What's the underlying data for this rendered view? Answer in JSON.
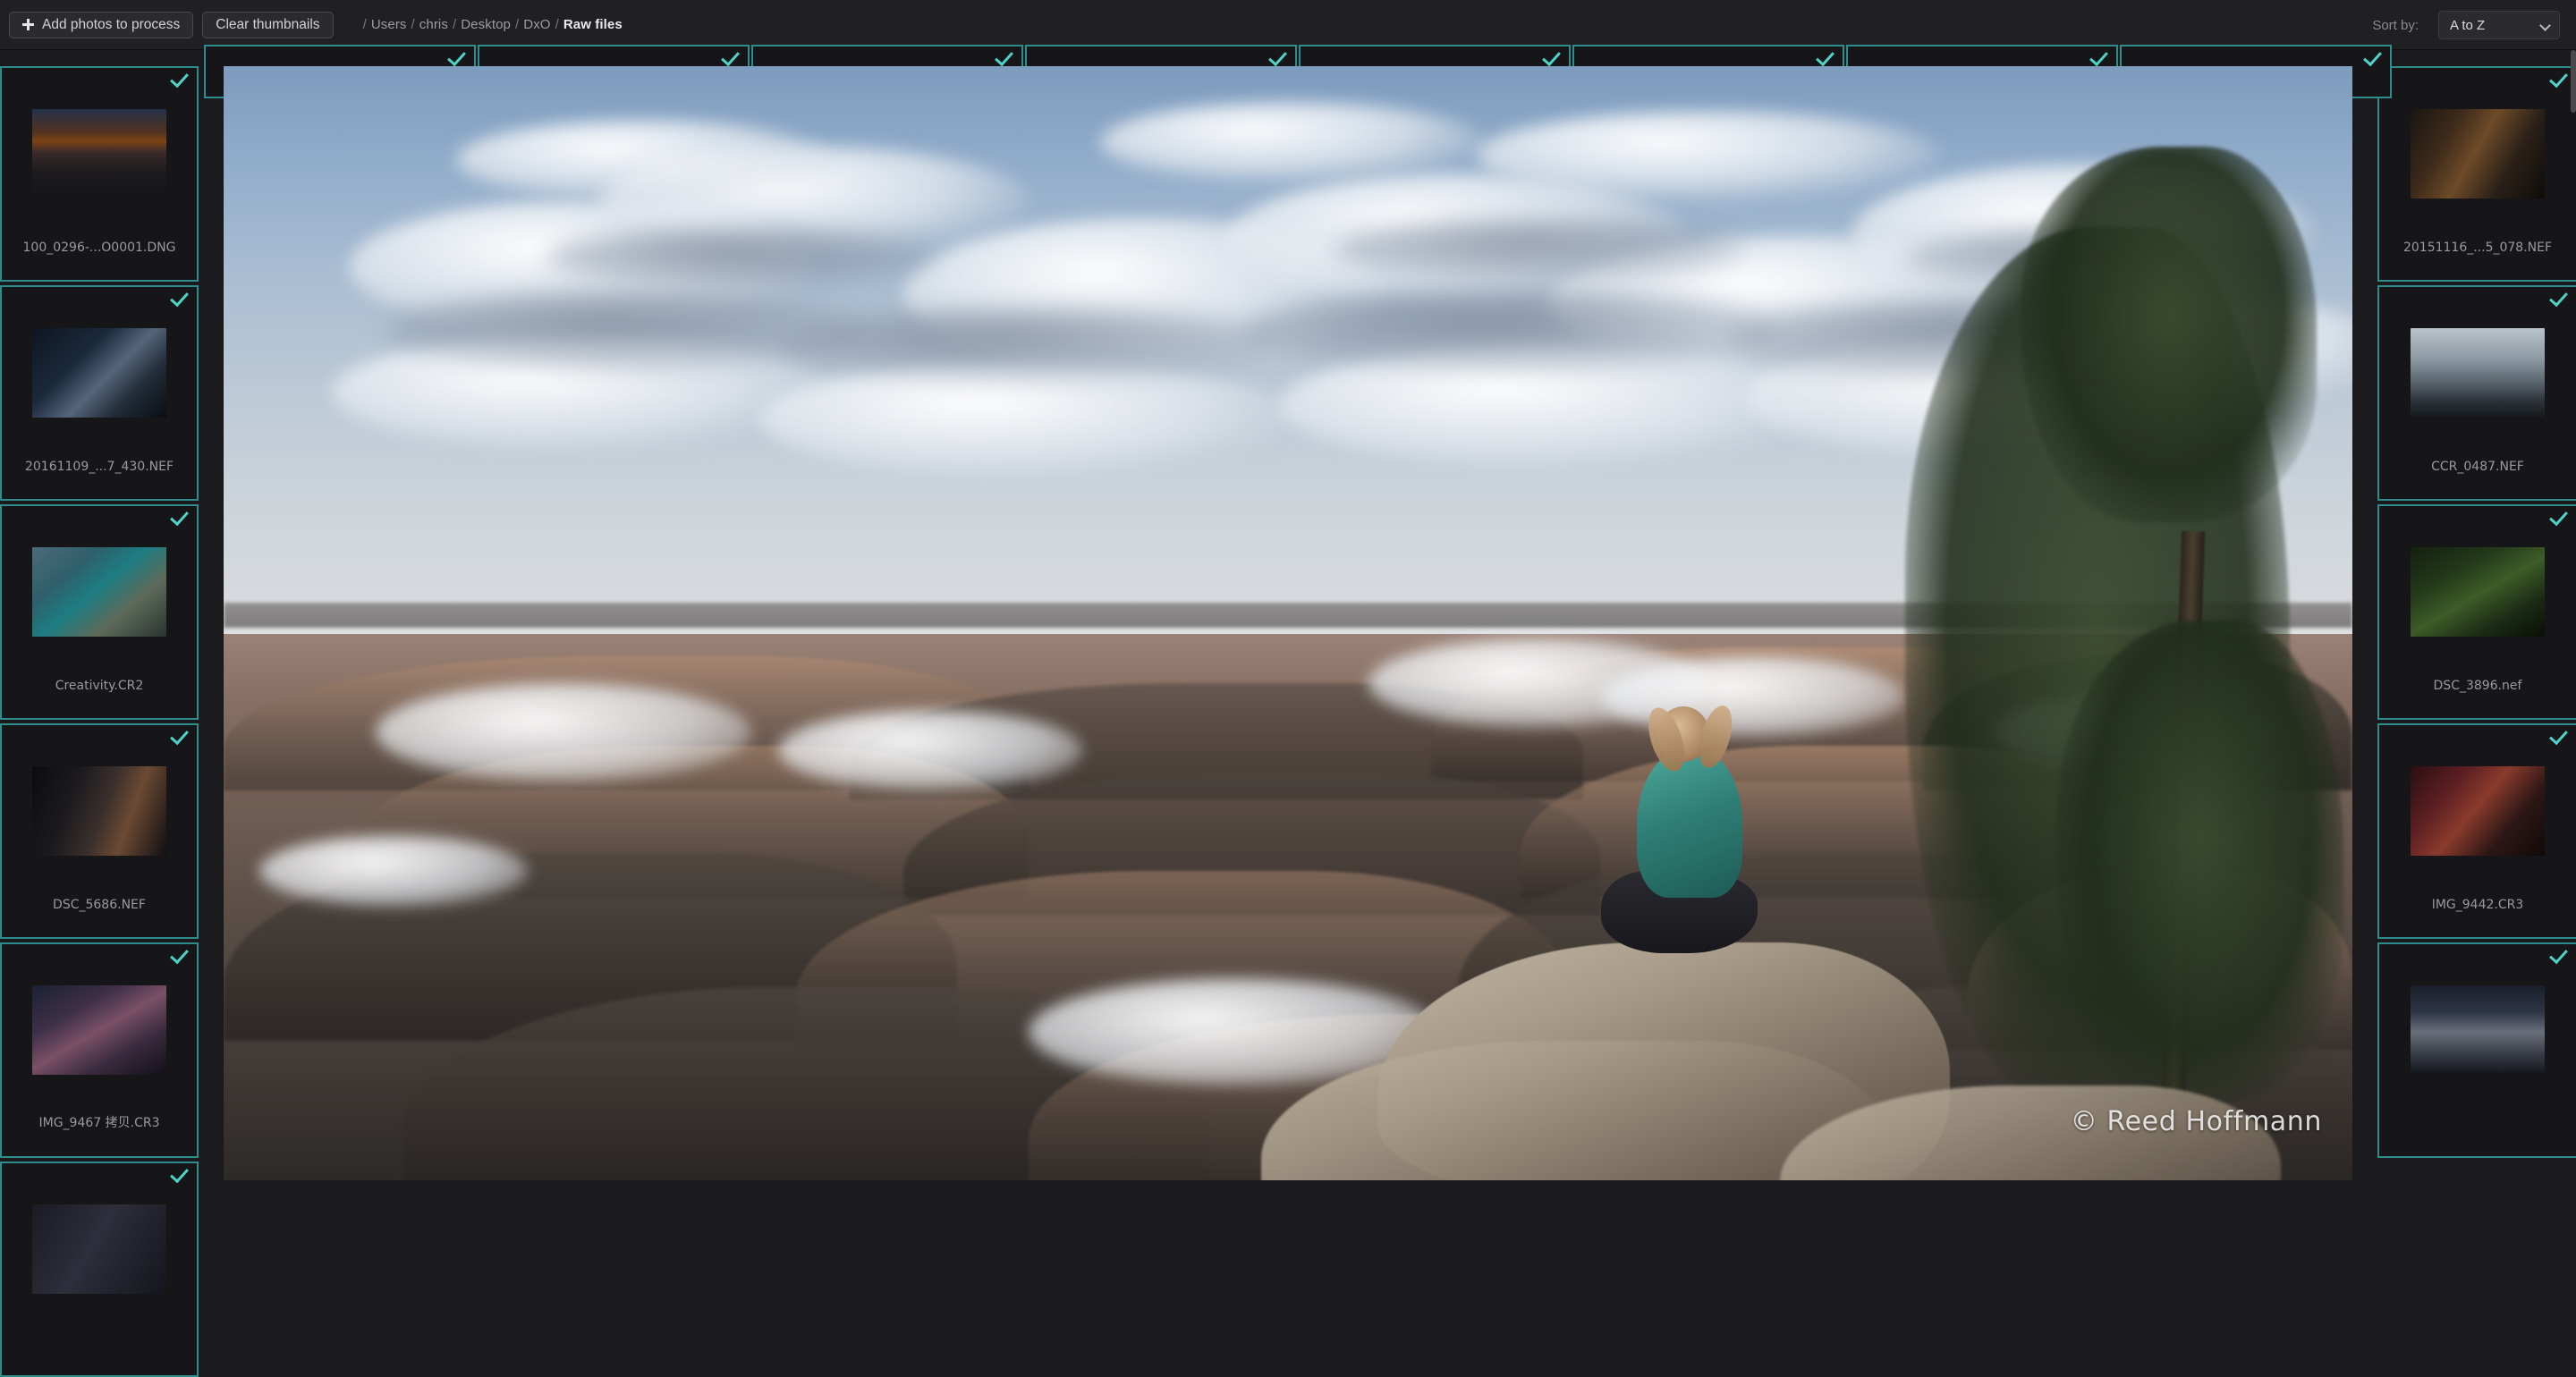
{
  "toolbar": {
    "add_photos_label": "Add photos to process",
    "add_photos_icon": "plus-icon",
    "clear_thumbnails_label": "Clear thumbnails",
    "breadcrumb": [
      "Users",
      "chris",
      "Desktop",
      "DxO",
      "Raw files"
    ],
    "breadcrumb_separator": "/",
    "sort_label": "Sort by:",
    "sort_value": "A to Z",
    "sort_chevron_icon": "chevron-down-icon"
  },
  "theme": {
    "accent": "#4fd3c8",
    "cell_border": "#2e8c8c",
    "background": "#1a1a1c",
    "toolbar_bg": "#202022",
    "text": "#d2d2d4",
    "muted_text": "#8b8b8f"
  },
  "preview": {
    "watermark": "© Reed Hoffmann",
    "alt": "Person seated on a rock ledge overlooking the Grand Canyon with clouds below"
  },
  "selected_tick_icon": "check-icon",
  "left_column": [
    {
      "filename": "100_0296-...O0001.DNG",
      "selected": true
    },
    {
      "filename": "20161109_...7_430.NEF",
      "selected": true
    },
    {
      "filename": "Creativity.CR2",
      "selected": true
    },
    {
      "filename": "DSC_5686.NEF",
      "selected": true
    },
    {
      "filename": "IMG_9467 拷贝.CR3",
      "selected": true
    },
    {
      "filename": "",
      "selected": true
    }
  ],
  "right_column": [
    {
      "filename": "20151116_...5_078.NEF",
      "selected": true
    },
    {
      "filename": "CCR_0487.NEF",
      "selected": true
    },
    {
      "filename": "DSC_3896.nef",
      "selected": true
    },
    {
      "filename": "IMG_9442.CR3",
      "selected": true
    },
    {
      "filename": "",
      "selected": true
    }
  ],
  "top_row": [
    {
      "filename": "",
      "selected": true
    },
    {
      "filename": "",
      "selected": true
    },
    {
      "filename": "",
      "selected": true
    },
    {
      "filename": "",
      "selected": true
    },
    {
      "filename": "",
      "selected": true
    },
    {
      "filename": "",
      "selected": true
    },
    {
      "filename": "",
      "selected": true
    },
    {
      "filename": "",
      "selected": true
    }
  ]
}
